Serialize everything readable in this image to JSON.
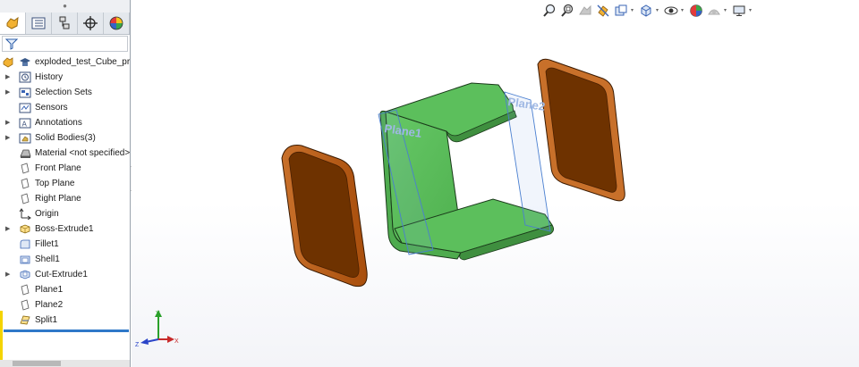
{
  "tree": {
    "root": {
      "label": "exploded_test_Cube_pro"
    },
    "items": [
      {
        "label": "History",
        "expandable": true,
        "icon": "history-icon"
      },
      {
        "label": "Selection Sets",
        "expandable": true,
        "icon": "selection-sets-icon"
      },
      {
        "label": "Sensors",
        "expandable": false,
        "icon": "sensors-icon"
      },
      {
        "label": "Annotations",
        "expandable": true,
        "icon": "annotations-icon"
      },
      {
        "label": "Solid Bodies(3)",
        "expandable": true,
        "icon": "solid-bodies-icon"
      },
      {
        "label": "Material <not specified>",
        "expandable": false,
        "icon": "material-icon"
      },
      {
        "label": "Front Plane",
        "expandable": false,
        "icon": "plane-icon"
      },
      {
        "label": "Top Plane",
        "expandable": false,
        "icon": "plane-icon"
      },
      {
        "label": "Right Plane",
        "expandable": false,
        "icon": "plane-icon"
      },
      {
        "label": "Origin",
        "expandable": false,
        "icon": "origin-icon"
      },
      {
        "label": "Boss-Extrude1",
        "expandable": true,
        "icon": "extrude-icon"
      },
      {
        "label": "Fillet1",
        "expandable": false,
        "icon": "fillet-icon"
      },
      {
        "label": "Shell1",
        "expandable": false,
        "icon": "shell-icon"
      },
      {
        "label": "Cut-Extrude1",
        "expandable": true,
        "icon": "cut-extrude-icon"
      },
      {
        "label": "Plane1",
        "expandable": false,
        "icon": "plane-icon"
      },
      {
        "label": "Plane2",
        "expandable": false,
        "icon": "plane-icon"
      },
      {
        "label": "Split1",
        "expandable": false,
        "icon": "split-icon"
      }
    ]
  },
  "viewport": {
    "plane_labels": {
      "plane1": "Plane1",
      "plane2": "Plane2"
    },
    "triad": {
      "y": "Y",
      "z": "Z",
      "x": "X"
    }
  },
  "colors": {
    "body_green": "#5cbf5c",
    "body_orange": "#b85a14",
    "body_orange_dark": "#6e3200",
    "plane_blue": "#4a7fd0",
    "rollback_blue": "#2f78c8"
  }
}
